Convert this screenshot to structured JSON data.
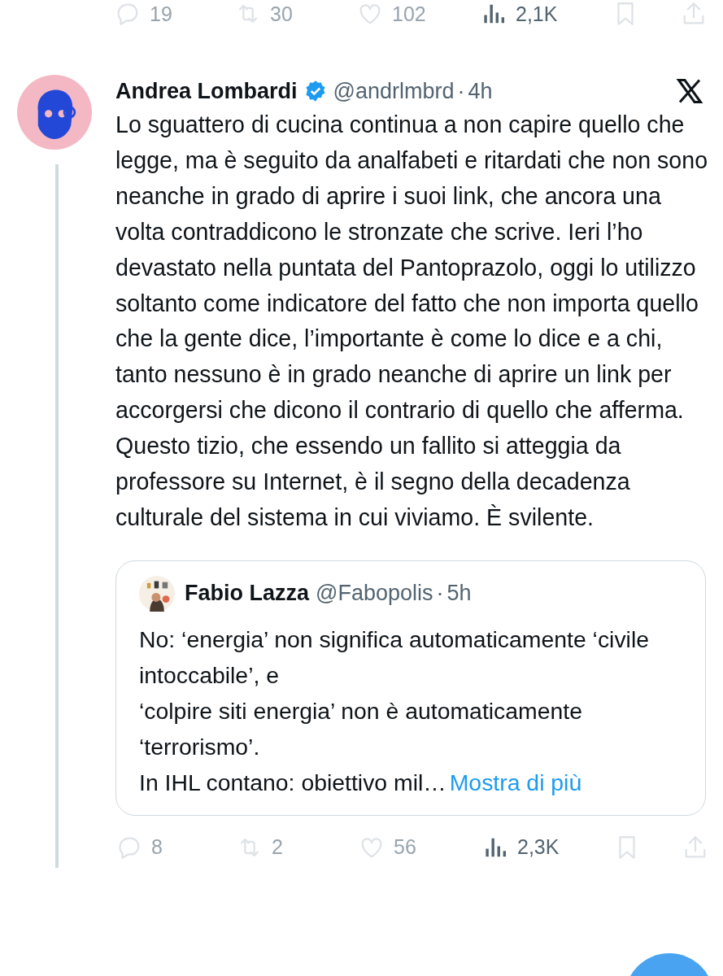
{
  "top_actions": [
    {
      "kind": "reply",
      "count": "19",
      "dimmed": true
    },
    {
      "kind": "repost",
      "count": "30",
      "dimmed": true
    },
    {
      "kind": "like",
      "count": "102",
      "dimmed": true
    },
    {
      "kind": "views",
      "count": "2,1K",
      "dimmed": false
    },
    {
      "kind": "bookmark",
      "dimmed": true
    },
    {
      "kind": "share",
      "dimmed": true
    }
  ],
  "post": {
    "author": "Andrea Lombardi",
    "verified": true,
    "handle": "@andrlmbrd",
    "separator": "·",
    "time": "4h",
    "text": "Lo sguattero di cucina continua a non capire quello che legge, ma è seguito da analfabeti e ritardati che non sono neanche in grado di aprire i suoi link, che ancora una volta contraddicono le stronzate che scrive. Ieri l’ho devastato nella puntata del Pantoprazolo, oggi lo utilizzo soltanto come indicatore del fatto che non importa quello che la gente dice, l’importante è come lo dice e a chi, tanto nessuno è in grado neanche di aprire un link per accorgersi che dicono il contrario di quello che afferma. Questo tizio, che essendo un fallito si atteggia da professore su Internet, è il segno della decadenza culturale del sistema in cui viviamo. È svilente.",
    "quote": {
      "author": "Fabio Lazza",
      "handle": "@Fabopolis",
      "separator": "·",
      "time": "5h",
      "lines": [
        "No: ‘energia’ non significa automaticamente ‘civile intoccabile’, e",
        "‘colpire siti energia’ non è automaticamente ‘terrorismo’."
      ],
      "last_line": "In IHL contano: obiettivo mil…",
      "more_link": "Mostra di più"
    },
    "actions": [
      {
        "kind": "reply",
        "count": "8",
        "dimmed": true
      },
      {
        "kind": "repost",
        "count": "2",
        "dimmed": true
      },
      {
        "kind": "like",
        "count": "56",
        "dimmed": true
      },
      {
        "kind": "views",
        "count": "2,3K",
        "dimmed": false
      },
      {
        "kind": "bookmark",
        "dimmed": true
      },
      {
        "kind": "share",
        "dimmed": true
      }
    ]
  }
}
